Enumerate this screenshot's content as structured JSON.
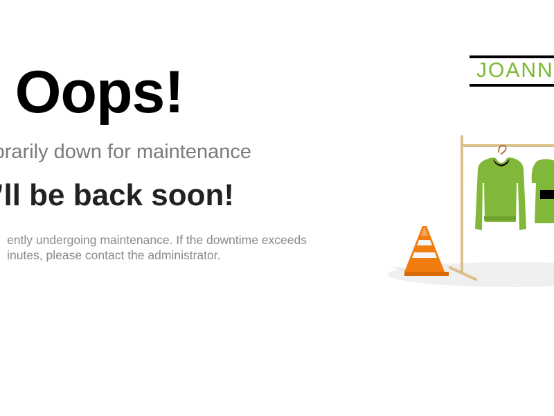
{
  "main": {
    "headline": "Oops!",
    "subtitle": "orarily down for maintenance",
    "back_soon": "e’ll be back soon!",
    "body_line1": "ently undergoing maintenance. If the downtime exceeds",
    "body_line2": "inutes, please contact the administrator."
  },
  "logo": {
    "text": "JOANN"
  },
  "illustration": {
    "icons": [
      "clothing-rack-icon",
      "sweater-icon",
      "dress-icon",
      "traffic-cone-icon",
      "hanger-icon"
    ]
  },
  "colors": {
    "brand_green": "#7ab830",
    "cone_orange": "#f07d0e",
    "rack_wood": "#dcc08a",
    "headline": "#000000",
    "subtitle": "#7a7a7a",
    "body": "#8a8a8a"
  }
}
